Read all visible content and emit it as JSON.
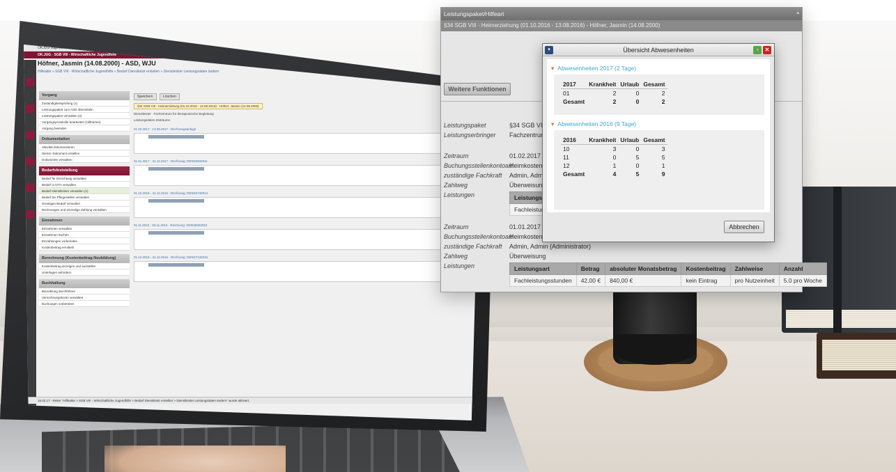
{
  "app": {
    "titlebar": "OKJUG Jugendhilfe",
    "menubar": "OK.JUG - SGB VIII - Wirtschaftliche Jugendhilfe",
    "client_name": "Höfner, Jasmin (14.08.2000) - ASD, WJU",
    "breadcrumb": "Hilfeakte » SGB VIII - Wirtschaftliche Jugendhilfe » Bedarf Dienstleistr erstellen » Dienstleister Leistungsdaten ändern",
    "statusbar": "15.02.17 - Reiter \"Hilfeakte > SGB VIII - Wirtschaftliche Jugendhilfe > Bedarf Dienstleistr erstellen > Dienstleister Leistungsdaten ändern\" wurde aktiviert.",
    "buttons": {
      "save": "Speichern",
      "delete": "Löschen"
    },
    "tab": "§34 SGB VIII - Heimerziehung (01.10.2016 - 13.08.2016) - Höfner, Jasmin (14.08.2000)",
    "dienstleister_label": "Dienstleister",
    "dienstleister_value": "Fachzentrum für therapeutische Begleitung",
    "leistungsdaten_label": "Leistungsdaten Zeiträume",
    "sidebar": {
      "groups": [
        {
          "label": "Vorgang",
          "active": false,
          "items": [
            "Zustandigkeitsprüfung (1)",
            "Leistungspaket zum ASD übermitteln",
            "Leistungspaket verwalten (2)",
            "Vorgangsprotokolle bearbeiten (Hilfearten)",
            "Vorgang beenden"
          ]
        },
        {
          "label": "Dokumentation",
          "active": false,
          "items": [
            "Aktivität dokumentieren",
            "Dienst- Dokument erstellen",
            "Dokumente verwalten"
          ]
        },
        {
          "label": "Bedarfsfeststellung",
          "active": true,
          "items": [
            "Bedarf für Einrichtung verwalten",
            "Bedarf in KITA verwalten",
            "Bedarf Dienstleister verwalten (1)",
            "Bedarf bei Pflegestellen verwalten",
            "Sonstigen Bedarf verwalten",
            "Rechnungen und einmalige Zahlung verwalten"
          ]
        },
        {
          "label": "Einnahmen",
          "active": false,
          "items": [
            "Einnahmen verwalten",
            "Einnahmen buchen",
            "Einzahlungen vorbereiten",
            "Kostenbeitrag ermitteln"
          ]
        },
        {
          "label": "Berechnung (Kostenbeitrag-Neubildung)",
          "active": false,
          "items": [
            "Kostenbeitrag anzeigen und ausstellen",
            "Unterlagen anfordern"
          ]
        },
        {
          "label": "Buchhaltung",
          "active": false,
          "items": [
            "Barzahlung durchführen",
            "Verrechnungskonto verwalten",
            "Buchungen vorbereiten"
          ]
        }
      ]
    },
    "entries": [
      {
        "title": "01.02.2017 - 13.08.2017 - Rechnungsanlage"
      },
      {
        "title": "01.01.2017 - 31.12.2017 - Rechnung: 000045832011"
      },
      {
        "title": "01.10.2016 - 31.12.2016 - Rechnung: 000046732014"
      },
      {
        "title": "01.11.2016 - 30.11.2016 - Rechnung: 000046832015"
      },
      {
        "title": "01.12.2016 - 31.12.2016 - Rechnung: 000047132016"
      }
    ]
  },
  "panel": {
    "title": "Leistungspaket/Hilfeart",
    "subtitle": "§34 SGB VIII - Heimerziehung (01.10.2016 - 13.08.2016) - Höfner, Jasmin (14.08.2000)",
    "weitere_funktionen": "Weitere Funktionen",
    "fields": {
      "leistungspaket_label": "Leistungspaket",
      "leistungspaket_value": "§34 SGB VIII -",
      "leistungserbringer_label": "Leistungserbringer",
      "leistungserbringer_value": "Fachzentrum",
      "zeitraum1_label": "Zeitraum",
      "zeitraum1_value": "01.02.2017 -",
      "buchung1_label": "Buchungsstellenkontoart",
      "buchung1_value": "Heimkosten",
      "fachkraft1_label": "zuständige Fachkraft",
      "fachkraft1_value": "Admin, Admin",
      "zahlweg1_label": "Zahlweg",
      "zahlweg1_value": "Überweisung",
      "leistungen1_label": "Leistungen",
      "leistungen1_head": "Leistungsar",
      "leistungen1_cell": "Fachleistung",
      "zeitraum2_label": "Zeitraum",
      "zeitraum2_value": "01.01.2017 -",
      "buchung2_label": "Buchungsstellenkontoart",
      "buchung2_value": "Heimkosten",
      "fachkraft2_label": "zuständige Fachkraft",
      "fachkraft2_value": "Admin, Admin (Administrator)",
      "zahlweg2_label": "Zahlweg",
      "zahlweg2_value": "Überweisung",
      "leistungen2_label": "Leistungen"
    },
    "leistungen_table": {
      "headers": [
        "Leistungsart",
        "Betrag",
        "absoluter Monatsbetrag",
        "Kostenbeitrag",
        "Zahlweise",
        "Anzahl"
      ],
      "row": [
        "Fachleistungsstunden",
        "42,00 €",
        "840,00 €",
        "kein Eintrag",
        "pro Nutzeinheit",
        "5.0 pro Woche"
      ]
    }
  },
  "dialog": {
    "title": "Übersicht Abwesenheiten",
    "cancel": "Abbrechen",
    "sections": [
      {
        "heading": "Abwesenheiten 2017 (2 Tage)",
        "headers": [
          "2017",
          "Krankheit",
          "Urlaub",
          "Gesamt"
        ],
        "rows": [
          [
            "01",
            "2",
            "0",
            "2"
          ]
        ],
        "total": [
          "Gesamt",
          "2",
          "0",
          "2"
        ]
      },
      {
        "heading": "Abwesenheiten 2016 (9 Tage)",
        "headers": [
          "2016",
          "Krankheit",
          "Urlaub",
          "Gesamt"
        ],
        "rows": [
          [
            "10",
            "3",
            "0",
            "3"
          ],
          [
            "11",
            "0",
            "5",
            "5"
          ],
          [
            "12",
            "1",
            "0",
            "1"
          ]
        ],
        "total": [
          "Gesamt",
          "4",
          "5",
          "9"
        ]
      }
    ]
  }
}
